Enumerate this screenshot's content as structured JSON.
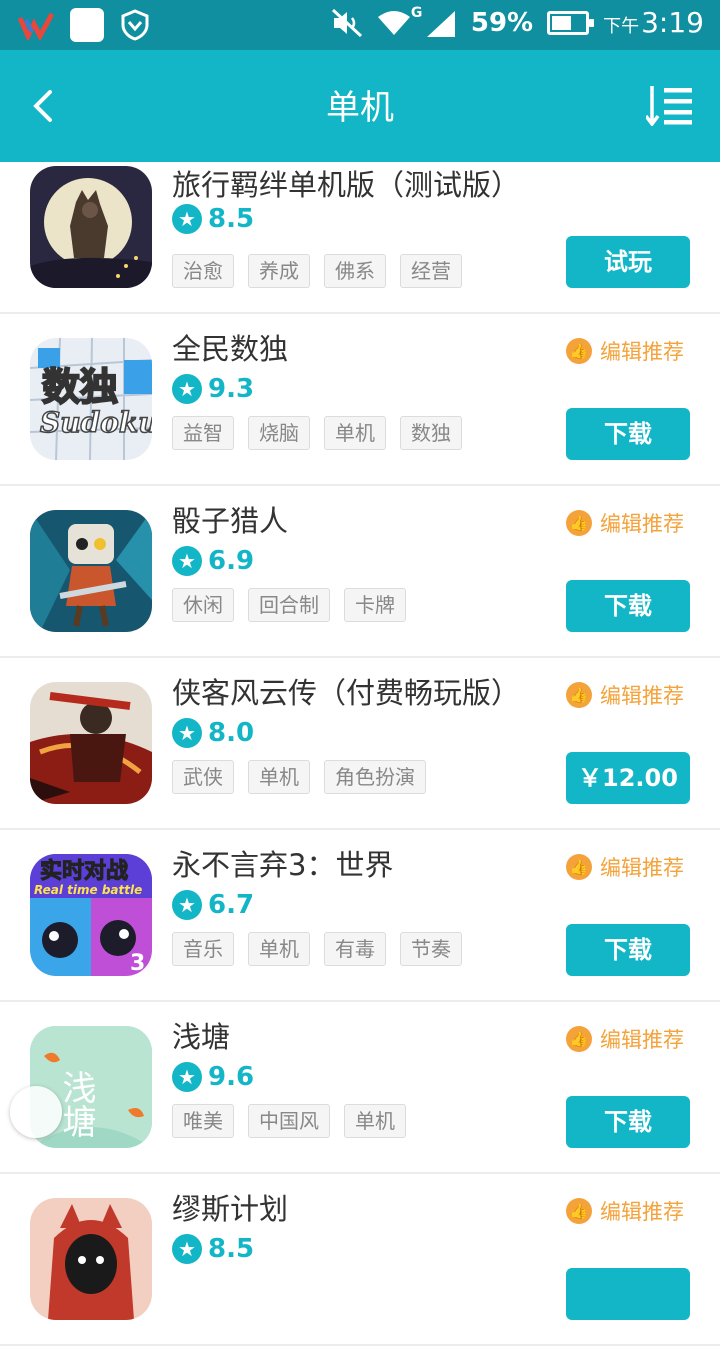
{
  "status_bar": {
    "signal_label": "G",
    "battery_percent": "59%",
    "battery_level": 0.59,
    "time_prefix": "下午",
    "time": "3:19"
  },
  "header": {
    "title": "单机",
    "back_icon": "chevron-left-icon",
    "sort_icon": "sort-list-icon"
  },
  "colors": {
    "brand": "#13b6c7",
    "status_bar": "#0f8f9f",
    "recommend": "#f4a23a"
  },
  "recommend_label": "编辑推荐",
  "games": [
    {
      "name": "旅行羁绊单机版（测试版）",
      "rating": "8.5",
      "tags": [
        "治愈",
        "养成",
        "佛系",
        "经营"
      ],
      "action": "试玩",
      "recommended": false
    },
    {
      "name": "全民数独",
      "rating": "9.3",
      "tags": [
        "益智",
        "烧脑",
        "单机",
        "数独"
      ],
      "action": "下载",
      "recommended": true
    },
    {
      "name": "骰子猎人",
      "rating": "6.9",
      "tags": [
        "休闲",
        "回合制",
        "卡牌"
      ],
      "action": "下载",
      "recommended": true
    },
    {
      "name": "侠客风云传（付费畅玩版）",
      "rating": "8.0",
      "tags": [
        "武侠",
        "单机",
        "角色扮演"
      ],
      "action": "￥12.00",
      "recommended": true
    },
    {
      "name": "永不言弃3：世界",
      "rating": "6.7",
      "tags": [
        "音乐",
        "单机",
        "有毒",
        "节奏"
      ],
      "action": "下载",
      "recommended": true
    },
    {
      "name": "浅塘",
      "rating": "9.6",
      "tags": [
        "唯美",
        "中国风",
        "单机"
      ],
      "action": "下载",
      "recommended": true
    },
    {
      "name": "缪斯计划",
      "rating": "8.5",
      "tags": [],
      "action": "",
      "recommended": true
    }
  ],
  "icon_text": {
    "sudoku_cn": "数独",
    "sudoku_en": "Sudoku",
    "realtime_cn": "实时对战",
    "realtime_en": "Real time battle",
    "pond_cn": "浅塘"
  }
}
